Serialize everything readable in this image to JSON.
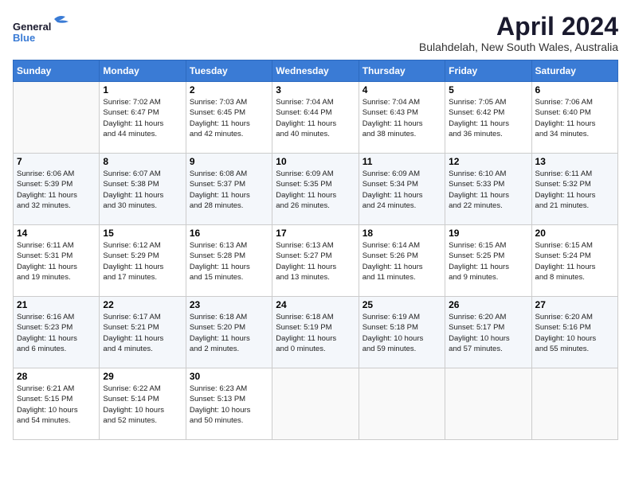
{
  "header": {
    "logo_general": "General",
    "logo_blue": "Blue",
    "month": "April 2024",
    "location": "Bulahdelah, New South Wales, Australia"
  },
  "days_of_week": [
    "Sunday",
    "Monday",
    "Tuesday",
    "Wednesday",
    "Thursday",
    "Friday",
    "Saturday"
  ],
  "weeks": [
    [
      {
        "day": "",
        "info": ""
      },
      {
        "day": "1",
        "info": "Sunrise: 7:02 AM\nSunset: 6:47 PM\nDaylight: 11 hours\nand 44 minutes."
      },
      {
        "day": "2",
        "info": "Sunrise: 7:03 AM\nSunset: 6:45 PM\nDaylight: 11 hours\nand 42 minutes."
      },
      {
        "day": "3",
        "info": "Sunrise: 7:04 AM\nSunset: 6:44 PM\nDaylight: 11 hours\nand 40 minutes."
      },
      {
        "day": "4",
        "info": "Sunrise: 7:04 AM\nSunset: 6:43 PM\nDaylight: 11 hours\nand 38 minutes."
      },
      {
        "day": "5",
        "info": "Sunrise: 7:05 AM\nSunset: 6:42 PM\nDaylight: 11 hours\nand 36 minutes."
      },
      {
        "day": "6",
        "info": "Sunrise: 7:06 AM\nSunset: 6:40 PM\nDaylight: 11 hours\nand 34 minutes."
      }
    ],
    [
      {
        "day": "7",
        "info": "Sunrise: 6:06 AM\nSunset: 5:39 PM\nDaylight: 11 hours\nand 32 minutes."
      },
      {
        "day": "8",
        "info": "Sunrise: 6:07 AM\nSunset: 5:38 PM\nDaylight: 11 hours\nand 30 minutes."
      },
      {
        "day": "9",
        "info": "Sunrise: 6:08 AM\nSunset: 5:37 PM\nDaylight: 11 hours\nand 28 minutes."
      },
      {
        "day": "10",
        "info": "Sunrise: 6:09 AM\nSunset: 5:35 PM\nDaylight: 11 hours\nand 26 minutes."
      },
      {
        "day": "11",
        "info": "Sunrise: 6:09 AM\nSunset: 5:34 PM\nDaylight: 11 hours\nand 24 minutes."
      },
      {
        "day": "12",
        "info": "Sunrise: 6:10 AM\nSunset: 5:33 PM\nDaylight: 11 hours\nand 22 minutes."
      },
      {
        "day": "13",
        "info": "Sunrise: 6:11 AM\nSunset: 5:32 PM\nDaylight: 11 hours\nand 21 minutes."
      }
    ],
    [
      {
        "day": "14",
        "info": "Sunrise: 6:11 AM\nSunset: 5:31 PM\nDaylight: 11 hours\nand 19 minutes."
      },
      {
        "day": "15",
        "info": "Sunrise: 6:12 AM\nSunset: 5:29 PM\nDaylight: 11 hours\nand 17 minutes."
      },
      {
        "day": "16",
        "info": "Sunrise: 6:13 AM\nSunset: 5:28 PM\nDaylight: 11 hours\nand 15 minutes."
      },
      {
        "day": "17",
        "info": "Sunrise: 6:13 AM\nSunset: 5:27 PM\nDaylight: 11 hours\nand 13 minutes."
      },
      {
        "day": "18",
        "info": "Sunrise: 6:14 AM\nSunset: 5:26 PM\nDaylight: 11 hours\nand 11 minutes."
      },
      {
        "day": "19",
        "info": "Sunrise: 6:15 AM\nSunset: 5:25 PM\nDaylight: 11 hours\nand 9 minutes."
      },
      {
        "day": "20",
        "info": "Sunrise: 6:15 AM\nSunset: 5:24 PM\nDaylight: 11 hours\nand 8 minutes."
      }
    ],
    [
      {
        "day": "21",
        "info": "Sunrise: 6:16 AM\nSunset: 5:23 PM\nDaylight: 11 hours\nand 6 minutes."
      },
      {
        "day": "22",
        "info": "Sunrise: 6:17 AM\nSunset: 5:21 PM\nDaylight: 11 hours\nand 4 minutes."
      },
      {
        "day": "23",
        "info": "Sunrise: 6:18 AM\nSunset: 5:20 PM\nDaylight: 11 hours\nand 2 minutes."
      },
      {
        "day": "24",
        "info": "Sunrise: 6:18 AM\nSunset: 5:19 PM\nDaylight: 11 hours\nand 0 minutes."
      },
      {
        "day": "25",
        "info": "Sunrise: 6:19 AM\nSunset: 5:18 PM\nDaylight: 10 hours\nand 59 minutes."
      },
      {
        "day": "26",
        "info": "Sunrise: 6:20 AM\nSunset: 5:17 PM\nDaylight: 10 hours\nand 57 minutes."
      },
      {
        "day": "27",
        "info": "Sunrise: 6:20 AM\nSunset: 5:16 PM\nDaylight: 10 hours\nand 55 minutes."
      }
    ],
    [
      {
        "day": "28",
        "info": "Sunrise: 6:21 AM\nSunset: 5:15 PM\nDaylight: 10 hours\nand 54 minutes."
      },
      {
        "day": "29",
        "info": "Sunrise: 6:22 AM\nSunset: 5:14 PM\nDaylight: 10 hours\nand 52 minutes."
      },
      {
        "day": "30",
        "info": "Sunrise: 6:23 AM\nSunset: 5:13 PM\nDaylight: 10 hours\nand 50 minutes."
      },
      {
        "day": "",
        "info": ""
      },
      {
        "day": "",
        "info": ""
      },
      {
        "day": "",
        "info": ""
      },
      {
        "day": "",
        "info": ""
      }
    ]
  ]
}
